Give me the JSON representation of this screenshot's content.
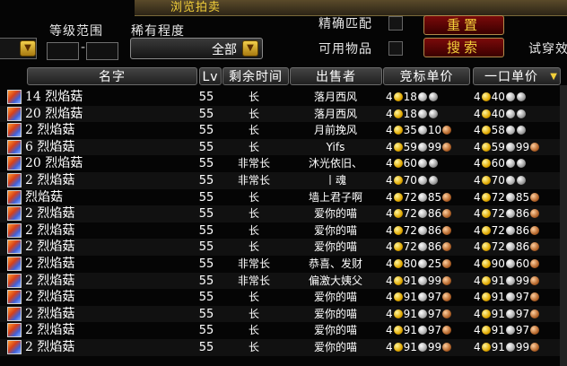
{
  "window": {
    "title": "浏览拍卖"
  },
  "filters": {
    "level_label": "等级范围",
    "rarity_label": "稀有程度",
    "rarity_value": "全部",
    "exact_label": "精确匹配",
    "usable_label": "可用物品",
    "reset_label": "重置",
    "search_label": "搜索",
    "tryon_label": "试穿效"
  },
  "columns": {
    "name": "名字",
    "lv": "Lv",
    "time": "剩余时间",
    "seller": "出售者",
    "bid": "竞标单价",
    "buyout": "一口单价"
  },
  "rows": [
    {
      "name": "14 烈焰菇",
      "lv": "55",
      "time": "长",
      "seller": "落月西风",
      "bid": [
        "4",
        "18",
        ""
      ],
      "buyout": [
        "4",
        "40",
        ""
      ]
    },
    {
      "name": "20 烈焰菇",
      "lv": "55",
      "time": "长",
      "seller": "落月西风",
      "bid": [
        "4",
        "18",
        ""
      ],
      "buyout": [
        "4",
        "40",
        ""
      ]
    },
    {
      "name": "2 烈焰菇",
      "lv": "55",
      "time": "长",
      "seller": "月前挽风",
      "bid": [
        "4",
        "35",
        "10"
      ],
      "buyout": [
        "4",
        "58",
        ""
      ]
    },
    {
      "name": "6 烈焰菇",
      "lv": "55",
      "time": "长",
      "seller": "Yifs",
      "bid": [
        "4",
        "59",
        "99"
      ],
      "buyout": [
        "4",
        "59",
        "99"
      ]
    },
    {
      "name": "20 烈焰菇",
      "lv": "55",
      "time": "非常长",
      "seller": "沐光依旧、",
      "bid": [
        "4",
        "60",
        ""
      ],
      "buyout": [
        "4",
        "60",
        ""
      ]
    },
    {
      "name": "2 烈焰菇",
      "lv": "55",
      "time": "非常长",
      "seller": "丨魂",
      "bid": [
        "4",
        "70",
        ""
      ],
      "buyout": [
        "4",
        "70",
        ""
      ]
    },
    {
      "name": "烈焰菇",
      "lv": "55",
      "time": "长",
      "seller": "墙上君子啊",
      "bid": [
        "4",
        "72",
        "85"
      ],
      "buyout": [
        "4",
        "72",
        "85"
      ]
    },
    {
      "name": "2 烈焰菇",
      "lv": "55",
      "time": "长",
      "seller": "爱你的喵",
      "bid": [
        "4",
        "72",
        "86"
      ],
      "buyout": [
        "4",
        "72",
        "86"
      ]
    },
    {
      "name": "2 烈焰菇",
      "lv": "55",
      "time": "长",
      "seller": "爱你的喵",
      "bid": [
        "4",
        "72",
        "86"
      ],
      "buyout": [
        "4",
        "72",
        "86"
      ]
    },
    {
      "name": "2 烈焰菇",
      "lv": "55",
      "time": "长",
      "seller": "爱你的喵",
      "bid": [
        "4",
        "72",
        "86"
      ],
      "buyout": [
        "4",
        "72",
        "86"
      ]
    },
    {
      "name": "2 烈焰菇",
      "lv": "55",
      "time": "非常长",
      "seller": "恭喜、发财",
      "bid": [
        "4",
        "80",
        "25"
      ],
      "buyout": [
        "4",
        "90",
        "60"
      ]
    },
    {
      "name": "2 烈焰菇",
      "lv": "55",
      "time": "非常长",
      "seller": "偏激大姨父",
      "bid": [
        "4",
        "91",
        "99"
      ],
      "buyout": [
        "4",
        "91",
        "99"
      ]
    },
    {
      "name": "2 烈焰菇",
      "lv": "55",
      "time": "长",
      "seller": "爱你的喵",
      "bid": [
        "4",
        "91",
        "97"
      ],
      "buyout": [
        "4",
        "91",
        "97"
      ]
    },
    {
      "name": "2 烈焰菇",
      "lv": "55",
      "time": "长",
      "seller": "爱你的喵",
      "bid": [
        "4",
        "91",
        "97"
      ],
      "buyout": [
        "4",
        "91",
        "97"
      ]
    },
    {
      "name": "2 烈焰菇",
      "lv": "55",
      "time": "长",
      "seller": "爱你的喵",
      "bid": [
        "4",
        "91",
        "97"
      ],
      "buyout": [
        "4",
        "91",
        "97"
      ]
    },
    {
      "name": "2 烈焰菇",
      "lv": "55",
      "time": "长",
      "seller": "爱你的喵",
      "bid": [
        "4",
        "91",
        "99"
      ],
      "buyout": [
        "4",
        "91",
        "99"
      ]
    }
  ],
  "colors": {
    "accent": "#f2cf3a",
    "background": "#050505",
    "button_red": "#7a0a0a"
  }
}
